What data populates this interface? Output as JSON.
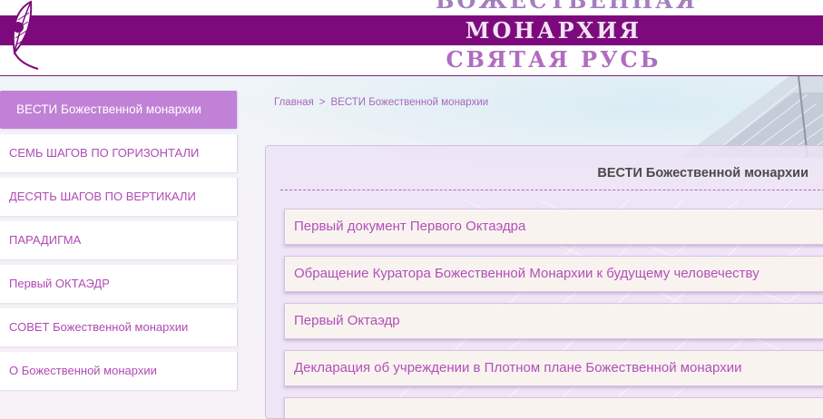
{
  "header": {
    "title_line1": "БОЖЕСТВЕННАЯ",
    "title_line2": "МОНАРХИЯ",
    "title_line3": "СВЯТАЯ РУСЬ"
  },
  "sidebar": {
    "items": [
      {
        "label": "ВЕСТИ Божественной монархии"
      },
      {
        "label": "СЕМЬ ШАГОВ ПО ГОРИЗОНТАЛИ"
      },
      {
        "label": "ДЕСЯТЬ ШАГОВ ПО ВЕРТИКАЛИ"
      },
      {
        "label": "ПАРАДИГМА"
      },
      {
        "label": "Первый ОКТАЭДР"
      },
      {
        "label": "СОВЕТ Божественной монархии"
      },
      {
        "label": "О Божественной монархии"
      }
    ]
  },
  "breadcrumb": {
    "home": "Главная",
    "separator": ">",
    "current": "ВЕСТИ Божественной монархии"
  },
  "content": {
    "title": "ВЕСТИ Божественной монархии",
    "articles": [
      {
        "title": "Первый документ Первого Октаэдра"
      },
      {
        "title": "Обращение Куратора Божественной Монархии к будущему человечеству"
      },
      {
        "title": "Первый Октаэдр"
      },
      {
        "title": "Декларация об учреждении в Плотном плане Божественной монархии"
      }
    ]
  },
  "colors": {
    "brand_purple": "#7d0a7c",
    "link_purple": "#b24fbb",
    "active_nav": "#c081d6"
  }
}
